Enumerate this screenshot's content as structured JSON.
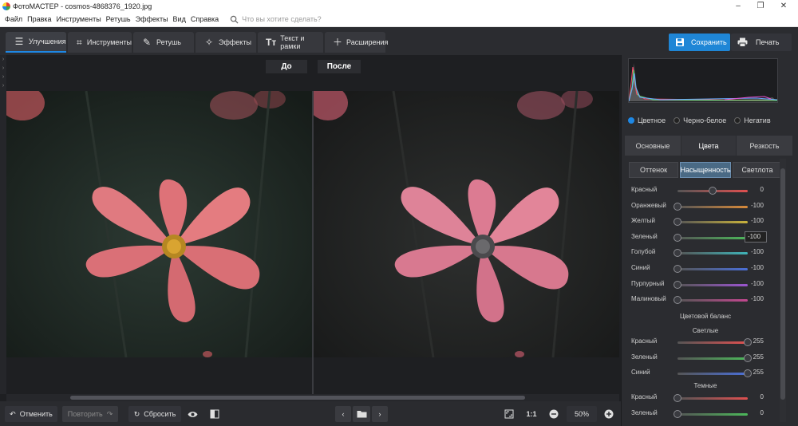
{
  "window": {
    "title": "ФотоМАСТЕР - cosmos-4868376_1920.jpg",
    "min": "–",
    "max": "❐",
    "close": "✕"
  },
  "menu": {
    "items": [
      "Файл",
      "Правка",
      "Инструменты",
      "Ретушь",
      "Эффекты",
      "Вид",
      "Справка"
    ],
    "search_placeholder": "Что вы хотите сделать?"
  },
  "toolbar": {
    "tabs": [
      {
        "label": "Улучшения",
        "icon": "sliders-icon"
      },
      {
        "label": "Инструменты",
        "icon": "crop-icon"
      },
      {
        "label": "Ретушь",
        "icon": "brush-icon"
      },
      {
        "label": "Эффекты",
        "icon": "magic-wand-icon"
      },
      {
        "label": "Текст и рамки",
        "icon": "text-icon"
      },
      {
        "label": "Расширения",
        "icon": "plus-icon"
      }
    ],
    "save_label": "Сохранить",
    "print_label": "Печать"
  },
  "compare": {
    "before": "До",
    "after": "После"
  },
  "bottom": {
    "undo": "Отменить",
    "redo": "Повторить",
    "reset": "Сбросить",
    "ratio": "1:1",
    "zoom": "50%"
  },
  "panel": {
    "modes": {
      "color": "Цветное",
      "bw": "Черно-белое",
      "neg": "Негатив",
      "selected": "color"
    },
    "tabs": [
      "Основные",
      "Цвета",
      "Резкость"
    ],
    "active_tab": "Цвета",
    "subtabs": [
      "Оттенок",
      "Насыщенность",
      "Светлота"
    ],
    "active_subtab": "Насыщенность",
    "saturation": [
      {
        "name": "Красный",
        "value": "0",
        "color": "#e05050",
        "level": 0.5
      },
      {
        "name": "Оранжевый",
        "value": "-100",
        "color": "#d88a3a",
        "level": 0
      },
      {
        "name": "Желтый",
        "value": "-100",
        "color": "#c9b23c",
        "level": 0
      },
      {
        "name": "Зеленый",
        "value": "-100",
        "color": "#4cb85a",
        "level": 0
      },
      {
        "name": "Голубой",
        "value": "-100",
        "color": "#3fb3b8",
        "level": 0
      },
      {
        "name": "Синий",
        "value": "-100",
        "color": "#4a6fd8",
        "level": 0
      },
      {
        "name": "Пурпурный",
        "value": "-100",
        "color": "#9b55d0",
        "level": 0
      },
      {
        "name": "Малиновый",
        "value": "-100",
        "color": "#c2478f",
        "level": 0
      }
    ],
    "balance_title": "Цветовой баланс",
    "light_title": "Светлые",
    "light": [
      {
        "name": "Красный",
        "value": "255",
        "color": "#e05050",
        "level": 1
      },
      {
        "name": "Зеленый",
        "value": "255",
        "color": "#4cb85a",
        "level": 1
      },
      {
        "name": "Синий",
        "value": "255",
        "color": "#4a6fd8",
        "level": 1
      }
    ],
    "dark_title": "Темные",
    "dark": [
      {
        "name": "Красный",
        "value": "0",
        "color": "#e05050",
        "level": 0
      },
      {
        "name": "Зеленый",
        "value": "0",
        "color": "#4cb85a",
        "level": 0
      }
    ]
  }
}
